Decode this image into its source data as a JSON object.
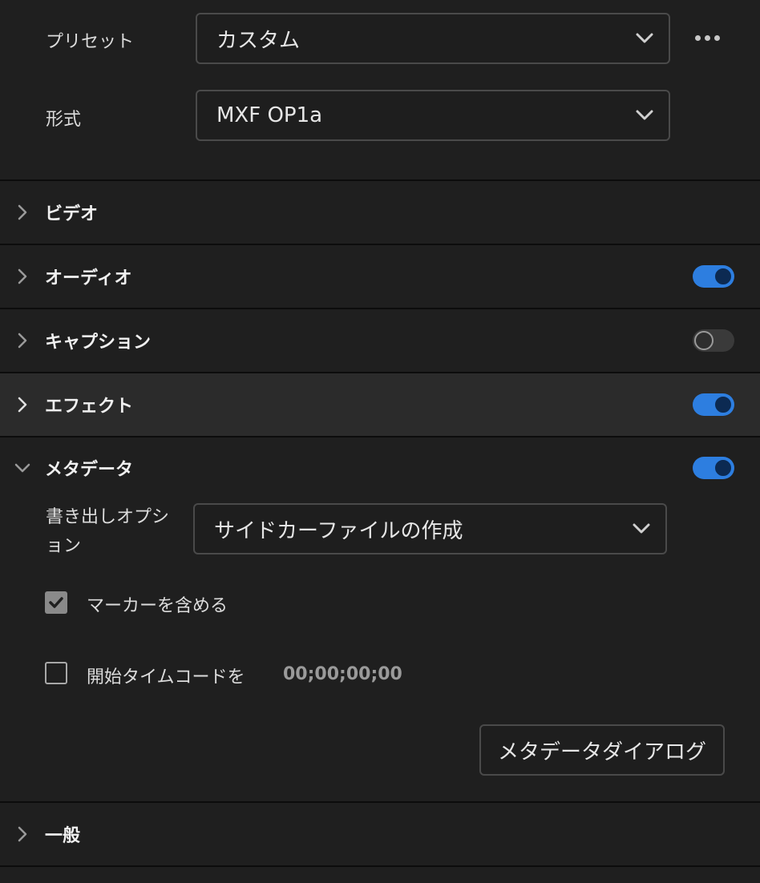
{
  "preset": {
    "label": "プリセット",
    "value": "カスタム",
    "more_icon": "ellipsis-icon"
  },
  "format": {
    "label": "形式",
    "value": "MXF OP1a"
  },
  "sections": {
    "video": {
      "title": "ビデオ",
      "expanded": false
    },
    "audio": {
      "title": "オーディオ",
      "expanded": false,
      "enabled": true
    },
    "captions": {
      "title": "キャプション",
      "expanded": false,
      "enabled": false
    },
    "effects": {
      "title": "エフェクト",
      "expanded": false,
      "enabled": true
    },
    "metadata": {
      "title": "メタデータ",
      "expanded": true,
      "enabled": true
    },
    "general": {
      "title": "一般",
      "expanded": false
    }
  },
  "metadata": {
    "export_options_label_line1": "書き出しオプシ",
    "export_options_label_line2": "ョン",
    "export_options_value": "サイドカーファイルの作成",
    "include_markers_label": "マーカーを含める",
    "include_markers_checked": true,
    "start_timecode_label": "開始タイムコードを",
    "start_timecode_checked": false,
    "start_timecode_value": "00;00;00;00",
    "dialog_button_label": "メタデータダイアログ"
  },
  "colors": {
    "accent": "#2d7ee0",
    "background": "#1f1f1f",
    "active_row": "#2b2b2b"
  }
}
